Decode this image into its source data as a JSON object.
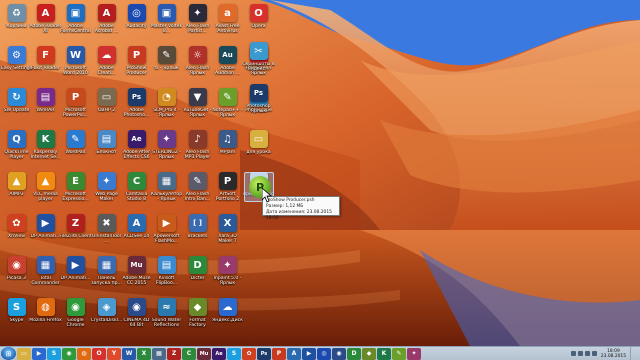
{
  "colors": {
    "sky": "#2c6ee0",
    "rock": "#d8642a",
    "taskbar": "#bccadb",
    "tooltip_bg": "#fafafa",
    "selection": "#96c8ff"
  },
  "desktop": {
    "columns": [
      [
        {
          "label": "Корзина",
          "icon": "recycle-bin-icon",
          "glyph": "♻",
          "color": "#6f8fa8"
        },
        {
          "label": "Easy Settings",
          "icon": "settings-icon",
          "glyph": "⚙",
          "color": "#3a7bd5"
        },
        {
          "label": "SW Update",
          "icon": "update-icon",
          "glyph": "↻",
          "color": "#2a8ad8"
        },
        {
          "label": "QuickTime Player",
          "icon": "quicktime-icon",
          "glyph": "Q",
          "color": "#2b6fc0"
        },
        {
          "label": "AIMP3",
          "icon": "aimp-icon",
          "glyph": "▲",
          "color": "#e0a020"
        },
        {
          "label": "XnView",
          "icon": "xnview-icon",
          "glyph": "✿",
          "color": "#d04020"
        },
        {
          "label": "Picasa 3",
          "icon": "picasa-icon",
          "glyph": "◉",
          "color": "#c8402e"
        },
        {
          "label": "Skype",
          "icon": "skype-icon",
          "glyph": "S",
          "color": "#1aa0e0"
        }
      ],
      [
        {
          "label": "Adobe Reader XI",
          "icon": "adobe-reader-icon",
          "glyph": "A",
          "color": "#c8201e"
        },
        {
          "label": "Foxit Reader",
          "icon": "foxit-reader-icon",
          "glyph": "F",
          "color": "#d23a20"
        },
        {
          "label": "WinRAR",
          "icon": "winrar-icon",
          "glyph": "▤",
          "color": "#7a2a8a"
        },
        {
          "label": "Kaspersky Internet Se...",
          "icon": "kaspersky-icon",
          "glyph": "K",
          "color": "#1d7a46"
        },
        {
          "label": "VLC media player",
          "icon": "vlc-icon",
          "glyph": "▲",
          "color": "#f08a10"
        },
        {
          "label": "DP Animati...",
          "icon": "dp-animation-icon",
          "glyph": "▶",
          "color": "#2050a0"
        },
        {
          "label": "Total Commander",
          "icon": "total-commander-icon",
          "glyph": "▦",
          "color": "#3060b0"
        },
        {
          "label": "Mozilla Firefox",
          "icon": "firefox-icon",
          "glyph": "◍",
          "color": "#e06a10"
        }
      ],
      [
        {
          "label": "Adobe FormsCentral",
          "icon": "forms-central-icon",
          "glyph": "▣",
          "color": "#1b6ec2"
        },
        {
          "label": "Microsoft Word 2010",
          "icon": "word-icon",
          "glyph": "W",
          "color": "#2858a8"
        },
        {
          "label": "Microsoft PowerPoi...",
          "icon": "powerpoint-icon",
          "glyph": "P",
          "color": "#c84a1c"
        },
        {
          "label": "WordPad",
          "icon": "wordpad-icon",
          "glyph": "✎",
          "color": "#2a7ad0"
        },
        {
          "label": "Microsoft Expressio...",
          "icon": "expression-icon",
          "glyph": "E",
          "color": "#3a8a30"
        },
        {
          "label": "FileZilla Client",
          "icon": "filezilla-icon",
          "glyph": "Z",
          "color": "#b0201c"
        },
        {
          "label": "DP Animati...",
          "icon": "dp-animation-icon",
          "glyph": "▶",
          "color": "#2050a0"
        },
        {
          "label": "Google Chrome",
          "icon": "chrome-icon",
          "glyph": "◉",
          "color": "#2e9a3a"
        }
      ],
      [
        {
          "label": "Adobe Acrobat ...",
          "icon": "acrobat-icon",
          "glyph": "A",
          "color": "#b51e1e"
        },
        {
          "label": "Adobe Creati...",
          "icon": "creative-cloud-icon",
          "glyph": "☁",
          "color": "#d0302e"
        },
        {
          "label": "ОВНР 2",
          "icon": "ovnr-icon",
          "glyph": "▭",
          "color": "#7a6a50"
        },
        {
          "label": "Блокнот",
          "icon": "notepad-icon",
          "glyph": "▤",
          "color": "#4a88c8"
        },
        {
          "label": "Web Page Maker",
          "icon": "web-page-maker-icon",
          "glyph": "✦",
          "color": "#3a7ad0"
        },
        {
          "label": "UninstallTool ...",
          "icon": "uninstall-tool-icon",
          "glyph": "✖",
          "color": "#5a5a5a"
        },
        {
          "label": "Панель запуска пр...",
          "icon": "launch-panel-icon",
          "glyph": "▦",
          "color": "#3a6ab0"
        },
        {
          "label": "CrystalDiskI...",
          "icon": "crystaldisk-icon",
          "glyph": "◈",
          "color": "#4a9ad0"
        }
      ],
      [
        {
          "label": "Audacity",
          "icon": "audacity-icon",
          "glyph": "◎",
          "color": "#1a4ab0"
        },
        {
          "label": "ProShow Producer",
          "icon": "proshow-icon",
          "glyph": "P",
          "color": "#c83a20"
        },
        {
          "label": "Adobe Photosho...",
          "icon": "photoshop-icon",
          "glyph": "Ps",
          "color": "#1c3a6a"
        },
        {
          "label": "Adobe After Effects CS6",
          "icon": "after-effects-icon",
          "glyph": "Ae",
          "color": "#3a1a6a"
        },
        {
          "label": "Camtasia Studio 8",
          "icon": "camtasia-icon",
          "glyph": "C",
          "color": "#2e8a3a"
        },
        {
          "label": "ACDSee 14",
          "icon": "acdsee-icon",
          "glyph": "A",
          "color": "#2a6ab0"
        },
        {
          "label": "Adobe Muse CC 2015",
          "icon": "muse-icon",
          "glyph": "Mu",
          "color": "#6a2a3a"
        },
        {
          "label": "CINEMA 4D 64 Bit",
          "icon": "cinema4d-icon",
          "glyph": "◉",
          "color": "#2a4a8a"
        }
      ],
      [
        {
          "label": "Master Voltek 8...",
          "icon": "master-voltek-icon",
          "glyph": "▣",
          "color": "#2a5ab0"
        },
        {
          "label": "fx - Ярлык",
          "icon": "fx-shortcut-icon",
          "glyph": "✎",
          "color": "#5a4a3a"
        },
        {
          "label": "SLM_Pro 4 - Ярлык",
          "icon": "slm-pro-icon",
          "glyph": "◔",
          "color": "#d08a20"
        },
        {
          "label": "STERLING2 - Ярлык",
          "icon": "sterling-icon",
          "glyph": "✦",
          "color": "#6a3a8a"
        },
        {
          "label": "Калькулятор - Ярлык",
          "icon": "calculator-icon",
          "glyph": "▦",
          "color": "#4a6a8a"
        },
        {
          "label": "Apowersoft FlashMo...",
          "icon": "flashmo-icon",
          "glyph": "▶",
          "color": "#c85a1c"
        },
        {
          "label": "Kvisoft FlipBoo...",
          "icon": "flipbook-icon",
          "glyph": "▤",
          "color": "#3a8ad0"
        },
        {
          "label": "Sound Water Reflections",
          "icon": "sound-water-icon",
          "glyph": "≈",
          "color": "#2a7ab0"
        }
      ],
      [
        {
          "label": "Aleo Flash Particl...",
          "icon": "aleo-particles-icon",
          "glyph": "✦",
          "color": "#2a2a3a"
        },
        {
          "label": "Aleo Flash Ярлык",
          "icon": "aleo-flash-icon",
          "glyph": "☼",
          "color": "#b0302a"
        },
        {
          "label": "RuTubeGet - Ярлык",
          "icon": "rutubeget-icon",
          "glyph": "▼",
          "color": "#3a3a4a"
        },
        {
          "label": "Aleo Flash MP3 Player",
          "icon": "aleo-mp3-icon",
          "glyph": "♪",
          "color": "#8a3a2a"
        },
        {
          "label": "Aleo Flash Intro Ban...",
          "icon": "aleo-intro-icon",
          "glyph": "✎",
          "color": "#5a5a6a"
        },
        {
          "label": "Brackets",
          "icon": "brackets-icon",
          "glyph": "[ ]",
          "color": "#3a6ab0"
        },
        {
          "label": "Dicter",
          "icon": "dicter-icon",
          "glyph": "D",
          "color": "#2a8a3a"
        },
        {
          "label": "Format Factory",
          "icon": "format-factory-icon",
          "glyph": "◆",
          "color": "#6a8a2a"
        }
      ],
      [
        {
          "label": "Avast Free Antivirus",
          "icon": "avast-icon",
          "glyph": "a",
          "color": "#e06a2a"
        },
        {
          "label": "Adobe Audition ...",
          "icon": "audition-icon",
          "glyph": "Au",
          "color": "#1a4a5a"
        },
        {
          "label": "Notepad++ - Ярлык",
          "icon": "notepad-plus-icon",
          "glyph": "✎",
          "color": "#6aa02a"
        },
        {
          "label": "MPJam",
          "icon": "mpjam-icon",
          "glyph": "♫",
          "color": "#3a5a8a"
        },
        {
          "label": "ArtSoft Portfolio 2",
          "icon": "portfolio-icon",
          "glyph": "P",
          "color": "#2a2a2a"
        },
        {
          "label": "Xara 3D Maker 7",
          "icon": "xara3d-icon",
          "glyph": "X",
          "color": "#2a5a9a"
        },
        {
          "label": "Inpaint 5.0 - Ярлык",
          "icon": "inpaint-icon",
          "glyph": "✦",
          "color": "#9a3a6a"
        },
        {
          "label": "Яндекс.Диск",
          "icon": "yandex-disk-icon",
          "glyph": "☁",
          "color": "#2a6ad0"
        }
      ],
      [
        {
          "label": "Opera",
          "icon": "opera-icon",
          "glyph": "O",
          "color": "#d8302a"
        },
        {
          "label": "FreeScreen Ярлык",
          "icon": "freescreen-icon",
          "glyph": "▣",
          "color": "#c8201e"
        },
        {
          "label": "Photoscape",
          "icon": "photoscape-icon",
          "glyph": "◉",
          "color": "#2a8ac8"
        },
        {
          "label": "для урока",
          "icon": "folder-icon",
          "glyph": "▭",
          "color": "#d8b040"
        },
        {
          "label": "природа.png",
          "icon": "png-file-icon",
          "glyph": "▤",
          "color": "#dcdcdc"
        }
      ],
      [
        {
          "label": "Скриншоты в Яндекс...",
          "icon": "yandex-screenshot-icon",
          "glyph": "✂",
          "color": "#3a9ad0"
        },
        {
          "label": "Photoshop Ярлык",
          "icon": "photoshop-shortcut-icon",
          "glyph": "Ps",
          "color": "#1c3a6a"
        }
      ]
    ],
    "selected_file": {
      "label": "ProShow Producer.psh",
      "icon": "proshow-file-icon",
      "glyph": "P"
    },
    "tooltip": {
      "line1": "ProShow Producer.psh",
      "line2": "Размер: 1,12 МБ",
      "line3": "Дата изменения: 23.08.2015 18:08"
    }
  },
  "taskbar": {
    "start_label": "Start",
    "pinned": [
      {
        "icon": "explorer-icon",
        "glyph": "▭",
        "color": "#d8b040"
      },
      {
        "icon": "media-player-icon",
        "glyph": "▶",
        "color": "#2a6ad0"
      },
      {
        "icon": "skype-icon",
        "glyph": "S",
        "color": "#1aa0e0"
      },
      {
        "icon": "chrome-icon",
        "glyph": "◉",
        "color": "#2e9a3a"
      },
      {
        "icon": "firefox-icon",
        "glyph": "◍",
        "color": "#e06a10"
      },
      {
        "icon": "opera-icon",
        "glyph": "O",
        "color": "#d8302a"
      },
      {
        "icon": "yandex-browser-icon",
        "glyph": "Y",
        "color": "#e04a2a"
      },
      {
        "icon": "word-icon",
        "glyph": "W",
        "color": "#2858a8"
      },
      {
        "icon": "excel-icon",
        "glyph": "X",
        "color": "#2a8a3a"
      },
      {
        "icon": "calculator-icon",
        "glyph": "▦",
        "color": "#4a6a8a"
      },
      {
        "icon": "filezilla-icon",
        "glyph": "Z",
        "color": "#b0201c"
      },
      {
        "icon": "camtasia-icon",
        "glyph": "C",
        "color": "#2e8a3a"
      },
      {
        "icon": "muse-icon",
        "glyph": "Mu",
        "color": "#6a2a3a"
      },
      {
        "icon": "after-effects-icon",
        "glyph": "Ae",
        "color": "#3a1a6a"
      },
      {
        "icon": "skype-icon",
        "glyph": "S",
        "color": "#1aa0e0"
      },
      {
        "icon": "xnview-icon",
        "glyph": "✿",
        "color": "#d04020"
      },
      {
        "icon": "photoshop-icon",
        "glyph": "Ps",
        "color": "#1c3a6a"
      },
      {
        "icon": "proshow-icon",
        "glyph": "P",
        "color": "#c83a20"
      },
      {
        "icon": "acdsee-icon",
        "glyph": "A",
        "color": "#2a6ab0"
      },
      {
        "icon": "dp-animation-icon",
        "glyph": "▶",
        "color": "#2050a0"
      },
      {
        "icon": "audacity-icon",
        "glyph": "◎",
        "color": "#1a4ab0"
      },
      {
        "icon": "cinema4d-icon",
        "glyph": "◉",
        "color": "#2a4a8a"
      },
      {
        "icon": "dicter-icon",
        "glyph": "D",
        "color": "#2a8a3a"
      },
      {
        "icon": "format-factory-icon",
        "glyph": "◆",
        "color": "#6a8a2a"
      },
      {
        "icon": "kaspersky-icon",
        "glyph": "K",
        "color": "#1d7a46"
      },
      {
        "icon": "notepad-plus-icon",
        "glyph": "✎",
        "color": "#6aa02a"
      },
      {
        "icon": "inpaint-icon",
        "glyph": "✦",
        "color": "#9a3a6a"
      }
    ],
    "clock": {
      "time": "18:09",
      "date": "23.08.2015"
    }
  }
}
